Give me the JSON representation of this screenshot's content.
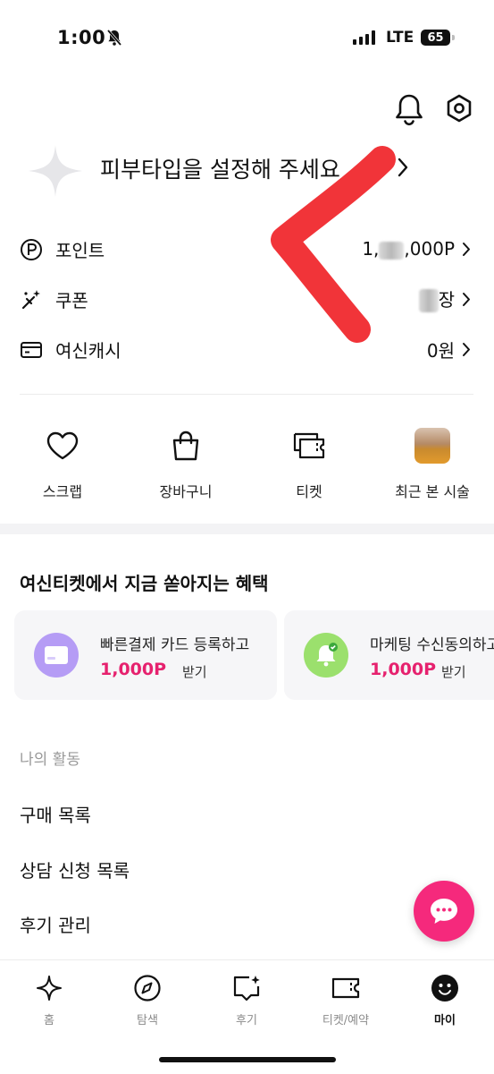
{
  "status_bar": {
    "time": "1:00",
    "network": "LTE",
    "battery": "65"
  },
  "header": {
    "icons": [
      "bell-icon",
      "settings-icon"
    ]
  },
  "profile": {
    "text": "피부타입을 설정해 주세요"
  },
  "summary": [
    {
      "icon": "point-icon",
      "label": "포인트",
      "value_prefix": "1,",
      "value_suffix": ",000P"
    },
    {
      "icon": "coupon-icon",
      "label": "쿠폰",
      "value_prefix": "",
      "value_suffix": "장"
    },
    {
      "icon": "cash-icon",
      "label": "여신캐시",
      "value_prefix": "",
      "value_suffix": "0원"
    }
  ],
  "quick_menu": [
    {
      "icon": "heart-icon",
      "label": "스크랩"
    },
    {
      "icon": "bag-icon",
      "label": "장바구니"
    },
    {
      "icon": "ticket-icon",
      "label": "티켓"
    },
    {
      "icon": "recent-thumbnail",
      "label": "최근 본 시술"
    }
  ],
  "benefits": {
    "title": "여신티켓에서 지금 쏟아지는 혜택",
    "cards": [
      {
        "icon": "card-icon",
        "icon_color": "#b59cf5",
        "title": "빠른결제 카드 등록하고",
        "amount": "1,000P",
        "suffix": "받기"
      },
      {
        "icon": "bell-check-icon",
        "icon_color": "#9be06d",
        "title": "마케팅 수신동의하고",
        "amount": "1,000P",
        "suffix": "받기"
      }
    ]
  },
  "activity": {
    "heading": "나의 활동",
    "items": [
      "구매 목록",
      "상담 신청 목록",
      "후기 관리"
    ]
  },
  "tabs": [
    {
      "icon": "sparkle-icon",
      "label": "홈"
    },
    {
      "icon": "compass-icon",
      "label": "탐색"
    },
    {
      "icon": "review-icon",
      "label": "후기"
    },
    {
      "icon": "ticket-icon",
      "label": "티켓/예약"
    },
    {
      "icon": "smile-icon",
      "label": "마이",
      "active": true
    }
  ],
  "colors": {
    "accent": "#e6216e",
    "fab": "#f5297c",
    "annotation": "#f0292e"
  }
}
